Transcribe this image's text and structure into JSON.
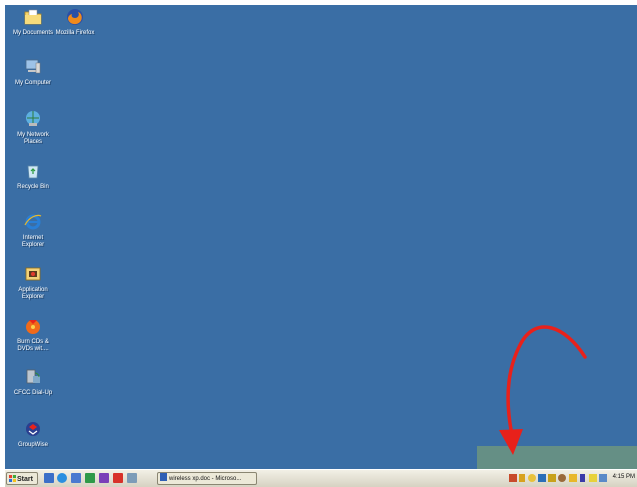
{
  "desktop": {
    "background_color": "#3a6ea5",
    "icons": [
      {
        "label": "My Documents",
        "icon": "folder-documents-icon"
      },
      {
        "label": "Mozilla Firefox",
        "icon": "firefox-icon"
      },
      {
        "label": "My Computer",
        "icon": "computer-icon"
      },
      {
        "label": "My Network\nPlaces",
        "icon": "network-places-icon"
      },
      {
        "label": "Recycle Bin",
        "icon": "recycle-bin-icon"
      },
      {
        "label": "Internet\nExplorer",
        "icon": "internet-explorer-icon"
      },
      {
        "label": "Application\nExplorer",
        "icon": "application-explorer-icon"
      },
      {
        "label": "Burn CDs &\nDVDs wit....",
        "icon": "burn-cd-icon"
      },
      {
        "label": "CFCC Dial-Up",
        "icon": "dial-up-icon"
      },
      {
        "label": "GroupWise",
        "icon": "groupwise-icon"
      }
    ]
  },
  "annotation": {
    "arrow_color": "#e8211b",
    "highlight_color": "#6d957f"
  },
  "taskbar": {
    "start_label": "Start",
    "quick_launch": [
      "outlook-icon",
      "internet-explorer-icon",
      "email-icon",
      "spreadsheet-icon",
      "acrobat-icon",
      "pdf-icon",
      "window-icon"
    ],
    "task_button_label": "wireless xp.doc - Microso...",
    "tray_icons": [
      "network-icon",
      "volume-icon",
      "signal-icon",
      "printer-icon",
      "flag-icon",
      "search-icon",
      "antivirus-icon",
      "battery-icon",
      "shield-icon",
      "display-icon"
    ],
    "clock": "4:15 PM"
  }
}
